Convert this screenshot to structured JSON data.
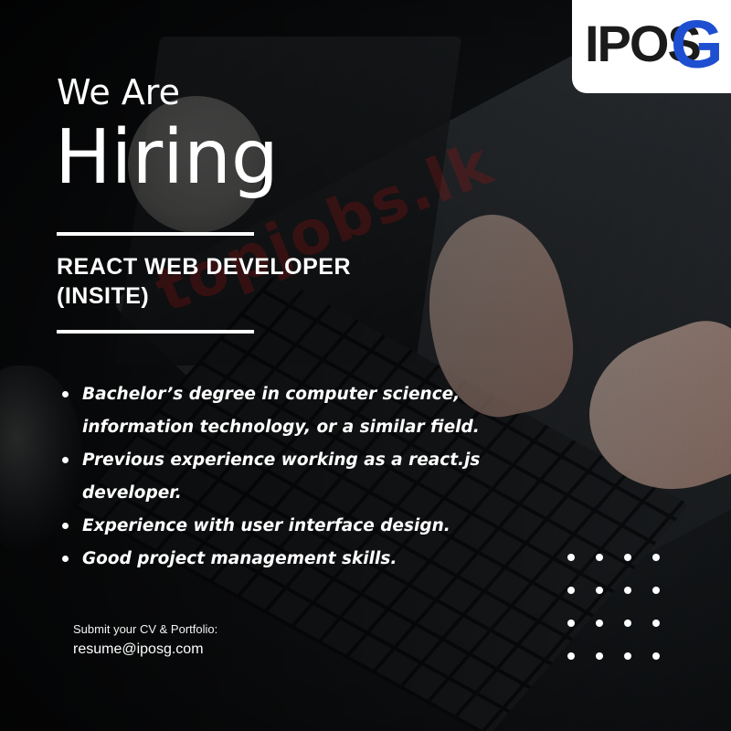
{
  "logo": {
    "text": "IPOS",
    "accent_letter": "G",
    "accent_color": "#1f4fd1"
  },
  "heading": {
    "line1": "We Are",
    "line2": "Hiring"
  },
  "job": {
    "title_line1": "REACT WEB DEVELOPER",
    "title_line2": "(INSITE)"
  },
  "requirements": [
    {
      "lines": [
        "Bachelor’s degree in computer science,",
        "information technology, or a similar field."
      ]
    },
    {
      "lines": [
        "Previous experience working as a react.js",
        "developer."
      ]
    },
    {
      "lines": [
        "Experience with user interface design."
      ]
    },
    {
      "lines": [
        "Good project management skills."
      ]
    }
  ],
  "contact": {
    "label": "Submit your CV & Portfolio:",
    "email": "resume@iposg.com"
  },
  "watermark": "topjobs.lk"
}
